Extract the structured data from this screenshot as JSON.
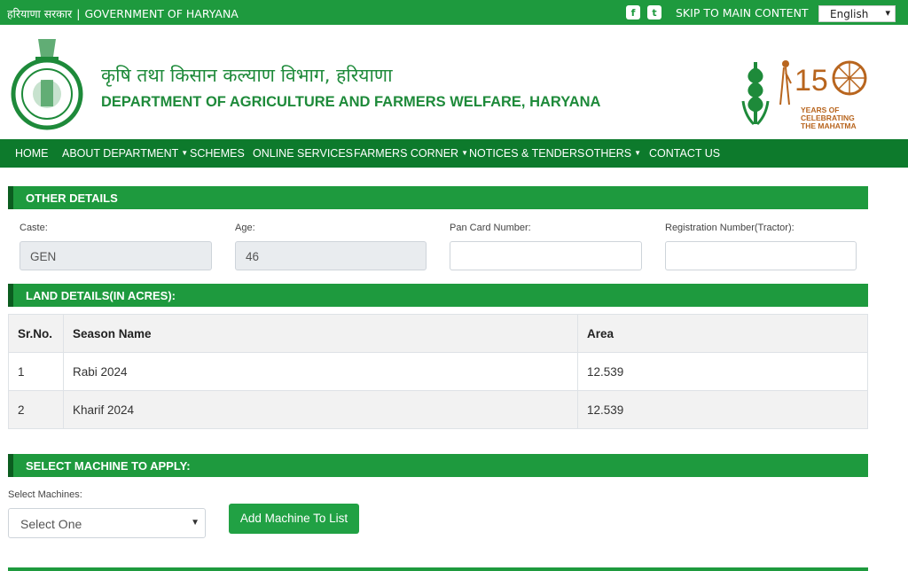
{
  "topbar": {
    "gov_hindi": "हरियाणा सरकार",
    "separator": "|",
    "gov_english": "GOVERNMENT OF HARYANA",
    "facebook_icon": "f",
    "twitter_icon": "t",
    "skip_link": "SKIP TO MAIN CONTENT",
    "language": "English"
  },
  "header": {
    "title_hindi": "कृषि तथा किसान कल्याण विभाग, हरियाणा",
    "title_english": "DEPARTMENT OF AGRICULTURE AND FARMERS WELFARE, HARYANA",
    "gandhi_line1": "YEARS OF",
    "gandhi_line2": "CELEBRATING",
    "gandhi_line3": "THE MAHATMA"
  },
  "nav": {
    "items": [
      {
        "label": "HOME"
      },
      {
        "label": "ABOUT DEPARTMENT"
      },
      {
        "label": "SCHEMES"
      },
      {
        "label": "ONLINE SERVICES"
      },
      {
        "label": "FARMERS CORNER"
      },
      {
        "label": "NOTICES & TENDERS"
      },
      {
        "label": "OTHERS"
      },
      {
        "label": "CONTACT US"
      }
    ]
  },
  "other_details": {
    "title": "OTHER DETAILS",
    "caste_label": "Caste:",
    "caste_value": "GEN",
    "age_label": "Age:",
    "age_value": "46",
    "pan_label": "Pan Card Number:",
    "pan_value": "",
    "reg_label": "Registration Number(Tractor):",
    "reg_value": ""
  },
  "land_details": {
    "title": "LAND DETAILS(IN ACRES):",
    "headers": [
      "Sr.No.",
      "Season Name",
      "Area"
    ],
    "rows": [
      [
        "1",
        "Rabi 2024",
        "12.539"
      ],
      [
        "2",
        "Kharif 2024",
        "12.539"
      ]
    ]
  },
  "machine": {
    "title": "SELECT MACHINE TO APPLY:",
    "select_label": "Select Machines:",
    "select_value": "Select One",
    "add_button": "Add Machine To List"
  },
  "colors": {
    "topbar": "#1e9a3e",
    "nav": "#0d7a2c",
    "title_green": "#1e8a3a",
    "button": "#21a144"
  },
  "icons": {
    "emblem": "haryana-emblem-icon",
    "wheat": "wheat-logo-icon",
    "gandhi": "gandhi-150-logo-icon",
    "dropdown": "chevron-down-icon"
  }
}
